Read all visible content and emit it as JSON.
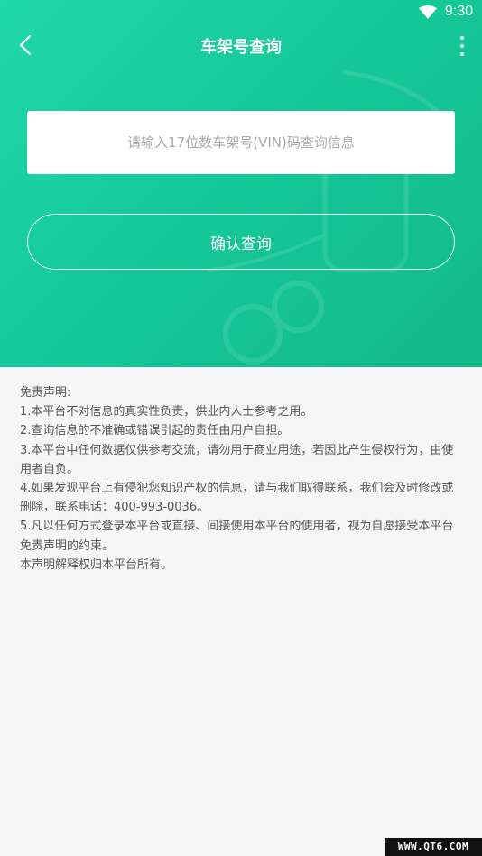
{
  "status_bar": {
    "time": "9:30",
    "wifi_icon": "wifi-icon"
  },
  "header": {
    "title": "车架号查询",
    "back_icon": "chevron-left-icon",
    "more_icon": "more-vertical-icon"
  },
  "form": {
    "vin_placeholder": "请输入17位数车架号(VIN)码查询信息",
    "vin_value": "",
    "confirm_label": "确认查询"
  },
  "disclaimer": {
    "lines": [
      "免责声明:",
      "1.本平台不对信息的真实性负责，供业内人士参考之用。",
      "2.查询信息的不准确或错误引起的责任由用户自担。",
      "3.本平台中任何数据仅供参考交流，请勿用于商业用途，若因此产生侵权行为，由使用者自负。",
      "4.如果发现平台上有侵犯您知识产权的信息，请与我们取得联系，我们会及时修改或删除，联系电话：400-993-0036。",
      "5.凡以任何方式登录本平台或直接、间接使用本平台的使用者，视为自愿接受本平台免责声明的约束。",
      "本声明解释权归本平台所有。"
    ]
  },
  "watermark": "WWW.QT6.COM",
  "colors": {
    "accent": "#1ccfa3",
    "background": "#f6f6f6",
    "text": "#555555"
  }
}
